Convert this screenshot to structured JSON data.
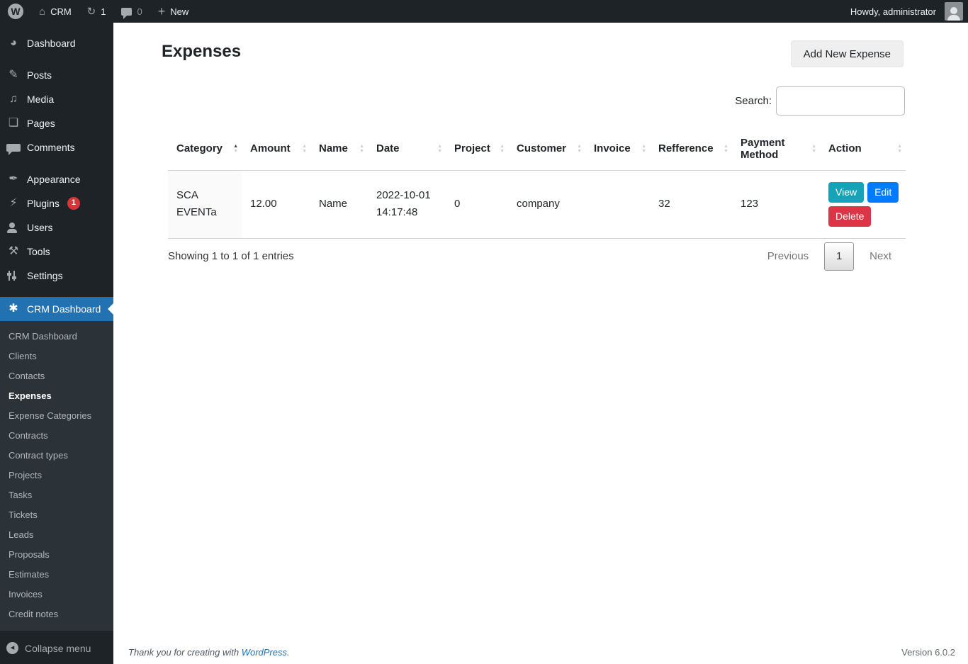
{
  "admin_bar": {
    "wp_logo": "W",
    "site_name": "CRM",
    "updates_count": "1",
    "comments_count": "0",
    "new_label": "New",
    "howdy": "Howdy, administrator"
  },
  "sidebar": {
    "items": [
      {
        "label": "Dashboard",
        "icon": "dashboard-icon",
        "glyph": "◕"
      },
      {
        "label": "Posts",
        "icon": "posts-icon",
        "glyph": "✎",
        "gap_before": true
      },
      {
        "label": "Media",
        "icon": "media-icon",
        "glyph": "♫"
      },
      {
        "label": "Pages",
        "icon": "pages-icon",
        "glyph": "❏"
      },
      {
        "label": "Comments",
        "icon": "comments-icon",
        "glyph": "css-bubble"
      },
      {
        "label": "Appearance",
        "icon": "appearance-icon",
        "glyph": "✒",
        "gap_before": true
      },
      {
        "label": "Plugins",
        "icon": "plugins-icon",
        "glyph": "⚡",
        "badge": "1"
      },
      {
        "label": "Users",
        "icon": "users-icon",
        "glyph": "css-person"
      },
      {
        "label": "Tools",
        "icon": "tools-icon",
        "glyph": "⚒"
      },
      {
        "label": "Settings",
        "icon": "settings-icon",
        "glyph": "css-sliders"
      }
    ],
    "crm": {
      "label": "CRM Dashboard",
      "icon": "gear-icon",
      "glyph": "✱"
    },
    "submenu": [
      "CRM Dashboard",
      "Clients",
      "Contacts",
      "Expenses",
      "Expense Categories",
      "Contracts",
      "Contract types",
      "Projects",
      "Tasks",
      "Tickets",
      "Leads",
      "Proposals",
      "Estimates",
      "Invoices",
      "Credit notes"
    ],
    "active_submenu": "Expenses",
    "collapse_label": "Collapse menu"
  },
  "page": {
    "title": "Expenses",
    "add_button": "Add New Expense",
    "search_label": "Search:",
    "search_value": ""
  },
  "table": {
    "headers": [
      "Category",
      "Amount",
      "Name",
      "Date",
      "Project",
      "Customer",
      "Invoice",
      "Refference",
      "Payment Method",
      "Action"
    ],
    "sorted_column": 0,
    "sorted_dir": "asc",
    "rows": [
      {
        "cells": [
          "SCA EVENTa",
          "12.00",
          "Name",
          "2022-10-01 14:17:48",
          "0",
          "company",
          "",
          "32",
          "123"
        ]
      }
    ],
    "actions": {
      "view": "View",
      "edit": "Edit",
      "delete": "Delete"
    },
    "info": "Showing 1 to 1 of 1 entries",
    "pagination": {
      "previous": "Previous",
      "current": "1",
      "next": "Next"
    }
  },
  "footer": {
    "thanks_prefix": "Thank you for creating with ",
    "link_text": "WordPress",
    "thanks_suffix": ".",
    "version": "Version 6.0.2"
  },
  "colors": {
    "admin_bar_bg": "#1d2327",
    "active_menu": "#2271b1",
    "plugins_badge": "#d63638",
    "view_button": "#17a2b8",
    "edit_button": "#007bff",
    "delete_button": "#dc3545",
    "link": "#2271b1"
  }
}
